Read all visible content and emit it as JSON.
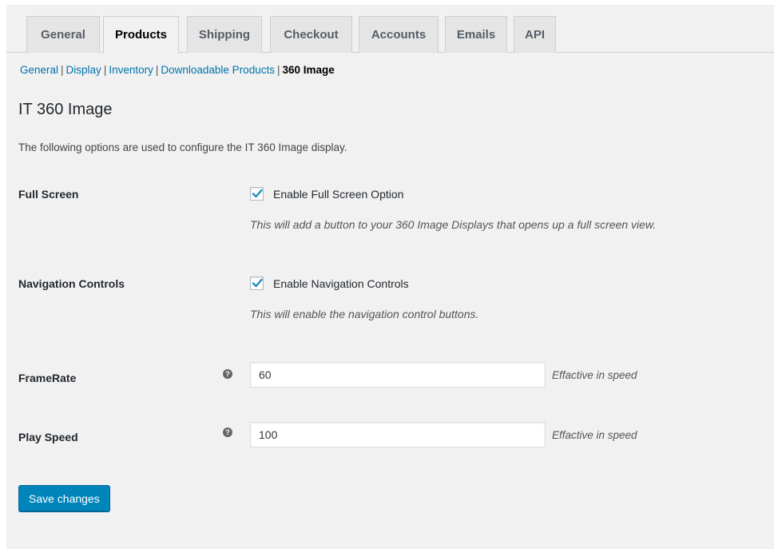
{
  "tabs": [
    {
      "label": "General",
      "active": false
    },
    {
      "label": "Products",
      "active": true
    },
    {
      "label": "Shipping",
      "active": false
    },
    {
      "label": "Checkout",
      "active": false
    },
    {
      "label": "Accounts",
      "active": false
    },
    {
      "label": "Emails",
      "active": false
    },
    {
      "label": "API",
      "active": false
    }
  ],
  "subnav": {
    "links": [
      "General",
      "Display",
      "Inventory",
      "Downloadable Products"
    ],
    "separator": "|",
    "current": "360 Image"
  },
  "section": {
    "title": "IT 360 Image",
    "description": "The following options are used to configure the IT 360 Image display."
  },
  "settings": {
    "full_screen": {
      "label": "Full Screen",
      "checkbox_label": "Enable Full Screen Option",
      "checked": true,
      "description": "This will add a button to your 360 Image Displays that opens up a full screen view."
    },
    "navigation_controls": {
      "label": "Navigation Controls",
      "checkbox_label": "Enable Navigation Controls",
      "checked": true,
      "description": "This will enable the navigation control buttons."
    },
    "frame_rate": {
      "label": "FrameRate",
      "value": "60",
      "note": "Effactive in speed",
      "help_icon": "?"
    },
    "play_speed": {
      "label": "Play Speed",
      "value": "100",
      "note": "Effactive in speed",
      "help_icon": "?"
    }
  },
  "save_button": {
    "label": "Save changes"
  },
  "colors": {
    "primary_button": "#0085ba",
    "link": "#0073aa",
    "checkmark": "#1e8cbe",
    "panel_background": "#f1f1f1"
  }
}
